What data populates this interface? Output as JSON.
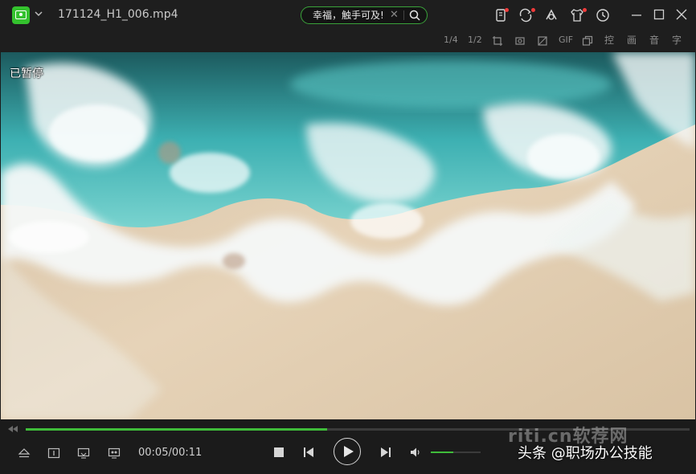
{
  "window": {
    "title": "171124_H1_006.mp4",
    "search_text": "幸福，触手可及!"
  },
  "toolbar": {
    "speed_quarter": "1/4",
    "speed_half": "1/2",
    "gif": "GIF",
    "control": "控",
    "picture": "画",
    "audio": "音",
    "subtitle": "字"
  },
  "video": {
    "status": "已暂停"
  },
  "playback": {
    "time": "00:05/00:11",
    "progress_fraction": 0.4545,
    "volume_fraction": 0.45
  },
  "watermark": {
    "site": "riti.cn软荐网",
    "credit": "头条 @职场办公技能"
  },
  "colors": {
    "accent": "#3fbc3a",
    "notification": "#f03b3b"
  }
}
